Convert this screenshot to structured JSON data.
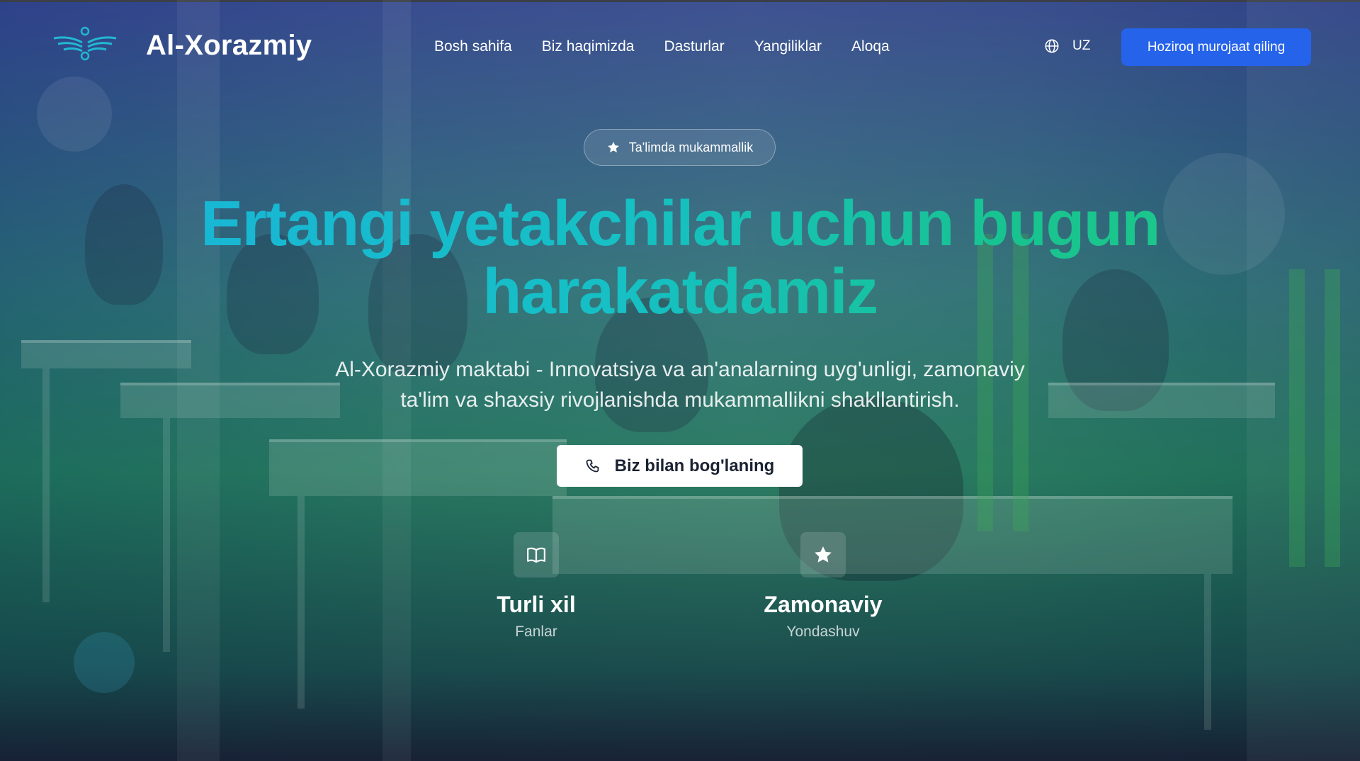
{
  "header": {
    "brand": "Al-Xorazmiy",
    "nav": [
      {
        "label": "Bosh sahifa"
      },
      {
        "label": "Biz haqimizda"
      },
      {
        "label": "Dasturlar"
      },
      {
        "label": "Yangiliklar"
      },
      {
        "label": "Aloqa"
      }
    ],
    "language": "UZ",
    "language_icon": "globe-icon",
    "cta_label": "Hoziroq murojaat qiling"
  },
  "hero": {
    "badge": {
      "icon": "star-icon",
      "label": "Ta'limda mukammallik"
    },
    "headline_line1": "Ertangi yetakchilar uchun bugun",
    "headline_line2": "harakatdamiz",
    "subtitle_line1": "Al-Xorazmiy maktabi - Innovatsiya va an'analarning uyg'unligi, zamonaviy",
    "subtitle_line2": "ta'lim va shaxsiy rivojlanishda mukammallikni shakllantirish.",
    "contact_button": {
      "icon": "phone-icon",
      "label": "Biz bilan bog'laning"
    }
  },
  "features": [
    {
      "icon": "book-icon",
      "title": "Turli xil",
      "subtitle": "Fanlar"
    },
    {
      "icon": "star-icon",
      "title": "Zamonaviy",
      "subtitle": "Yondashuv"
    }
  ],
  "colors": {
    "accent_button": "#2563eb",
    "headline_gradient_start": "#19b5d8",
    "headline_gradient_end": "#1ec98a"
  }
}
